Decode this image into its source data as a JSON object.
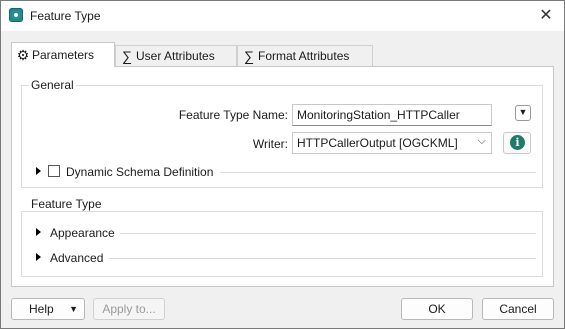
{
  "window": {
    "title": "Feature Type",
    "close_glyph": "✕"
  },
  "tabs": [
    {
      "label": "Parameters",
      "icon": "gear-icon",
      "glyph": "⚙"
    },
    {
      "label": "User Attributes",
      "icon": "sigma-icon",
      "glyph": "∑"
    },
    {
      "label": "Format Attributes",
      "icon": "sigma-icon",
      "glyph": "∑"
    }
  ],
  "general": {
    "title": "General",
    "feature_type_name_label": "Feature Type Name:",
    "feature_type_name_value": "MonitoringStation_HTTPCaller",
    "writer_label": "Writer:",
    "writer_value": "HTTPCallerOutput [OGCKML]",
    "writer_chevron": "⌵",
    "dropdown_glyph": "▼",
    "info_glyph": "i",
    "dynamic_schema_label": "Dynamic Schema Definition",
    "dynamic_schema_checked": false
  },
  "feature_type": {
    "title": "Feature Type",
    "appearance_label": "Appearance",
    "advanced_label": "Advanced"
  },
  "footer": {
    "help_label": "Help",
    "help_arrow": "▼",
    "apply_label": "Apply to...",
    "ok_label": "OK",
    "cancel_label": "Cancel"
  }
}
